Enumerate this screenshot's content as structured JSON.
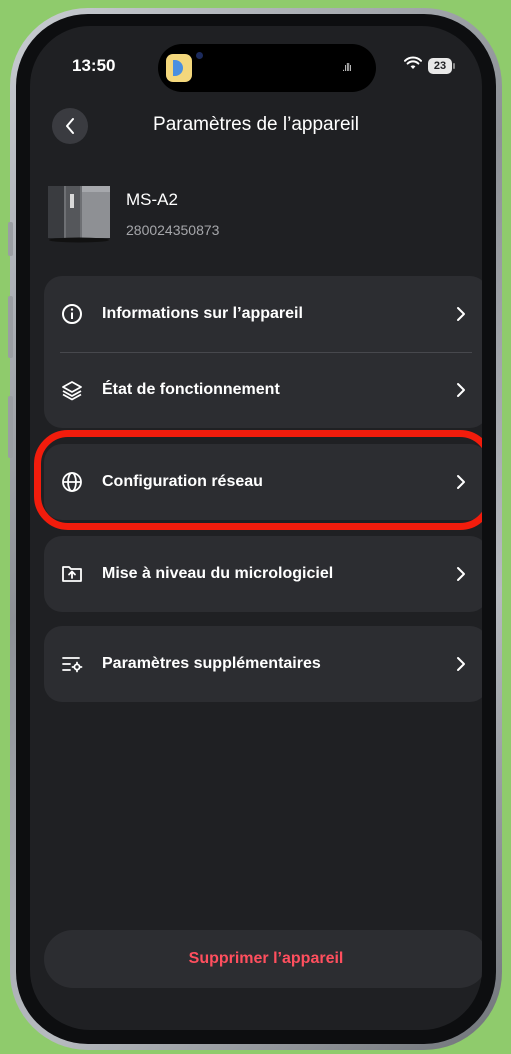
{
  "status_bar": {
    "time": "13:50",
    "signal_glyph": ".ıllı",
    "battery": "23"
  },
  "header": {
    "title": "Paramètres de l’appareil",
    "back_icon": "chevron-left-icon"
  },
  "device": {
    "name": "MS-A2",
    "serial": "280024350873"
  },
  "menu": {
    "group1": [
      {
        "label": "Informations sur l’appareil",
        "icon": "info-circle-icon"
      },
      {
        "label": "État de fonctionnement",
        "icon": "layers-icon"
      }
    ],
    "network": {
      "label": "Configuration réseau",
      "icon": "globe-icon"
    },
    "firmware": {
      "label": "Mise à niveau du micrologiciel",
      "icon": "folder-upload-icon"
    },
    "extra": {
      "label": "Paramètres supplémentaires",
      "icon": "settings-list-icon"
    }
  },
  "actions": {
    "delete_label": "Supprimer l’appareil"
  },
  "colors": {
    "background": "#8fcb6c",
    "screen": "#1f2023",
    "card": "#2c2d31",
    "highlight": "#f21c0c",
    "danger_text": "#ff4f5e"
  }
}
